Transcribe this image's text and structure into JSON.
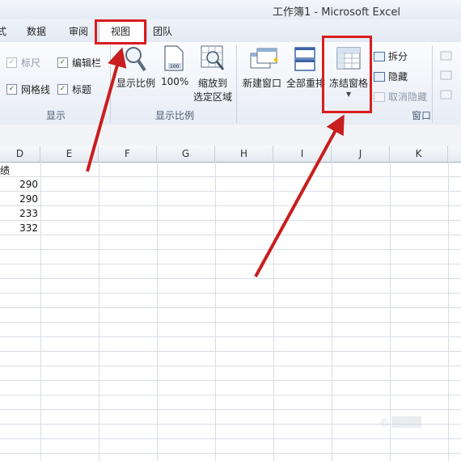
{
  "window": {
    "title": "工作簿1 - Microsoft Excel"
  },
  "tabs": [
    {
      "label": "式"
    },
    {
      "label": "数据"
    },
    {
      "label": "审阅"
    },
    {
      "label": "视图",
      "active": true
    },
    {
      "label": "团队"
    }
  ],
  "ribbon": {
    "show_group": {
      "label": "显示",
      "ruler": "标尺",
      "formula_bar": "编辑栏",
      "gridlines": "网格线",
      "headings": "标题"
    },
    "zoom_group": {
      "label": "显示比例",
      "zoom": "显示比例",
      "zoom100": "100%",
      "zoom_sel_line1": "缩放到",
      "zoom_sel_line2": "选定区域"
    },
    "window_group": {
      "label": "窗口",
      "new_window": "新建窗口",
      "arrange_all": "全部重排",
      "freeze_panes": "冻结窗格",
      "split": "拆分",
      "hide": "隐藏",
      "unhide": "取消隐藏"
    }
  },
  "grid": {
    "columns": [
      "D",
      "E",
      "F",
      "G",
      "H",
      "I",
      "J",
      "K"
    ],
    "cells": [
      "绩",
      "290",
      "290",
      "233",
      "332"
    ]
  },
  "colors": {
    "highlight": "#d91d1d",
    "arrow": "#c81e1e"
  }
}
